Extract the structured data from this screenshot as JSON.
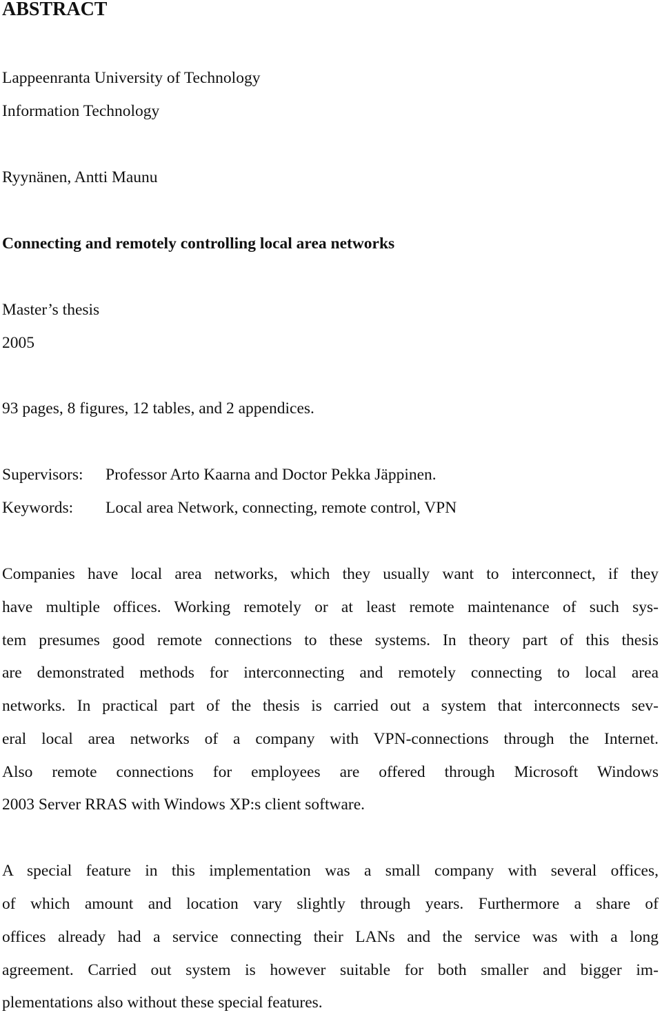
{
  "heading": "ABSTRACT",
  "university": "Lappeenranta University of Technology",
  "department": "Information Technology",
  "author": "Ryynänen, Antti Maunu",
  "thesis_title": "Connecting and remotely controlling local area networks",
  "thesis_type": "Master’s thesis",
  "year": "2005",
  "stats": "93 pages, 8 figures, 12 tables, and 2 appendices.",
  "supervisors": {
    "label": "Supervisors:",
    "value": "Professor Arto Kaarna and Doctor Pekka Jäppinen."
  },
  "keywords": {
    "label": "Keywords:",
    "value": "Local area Network, connecting, remote control, VPN"
  },
  "paragraphs": [
    {
      "lines": [
        "Companies have local area networks, which they usually want to interconnect, if they",
        "have multiple offices. Working remotely or at least remote maintenance of such sys-",
        "tem presumes good remote connections to these systems. In theory part of this thesis",
        "are demonstrated methods for interconnecting and remotely connecting to local area",
        "networks. In practical part of the thesis is carried out a system that interconnects sev-",
        "eral local area networks of a company with VPN-connections through the Internet.",
        "Also remote connections for employees are offered through Microsoft Windows",
        "2003 Server RRAS with Windows XP:s client software."
      ]
    },
    {
      "lines": [
        "A special feature in this implementation was a small company with several offices,",
        "of which amount and location vary slightly through years. Furthermore a share of",
        "offices already had a service connecting their LANs and the service was with a long",
        "agreement. Carried out system is however suitable for both smaller and bigger im-",
        "plementations also without these special features."
      ]
    }
  ]
}
